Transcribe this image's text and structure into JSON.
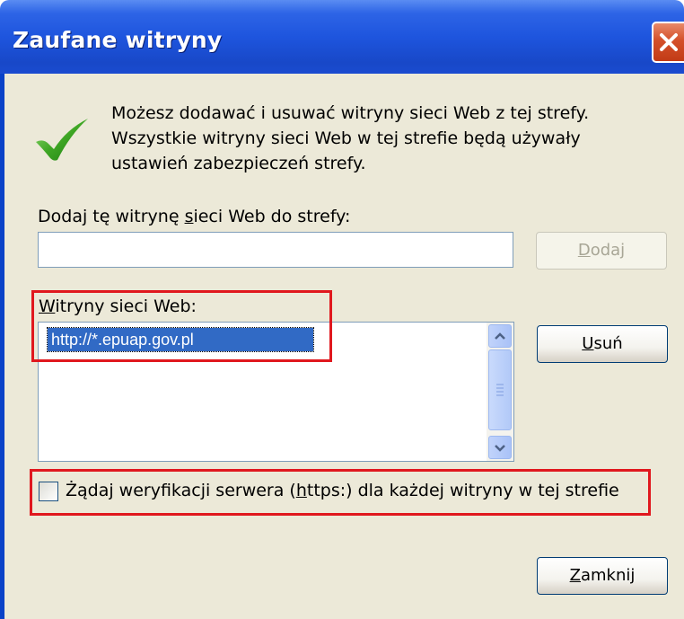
{
  "window": {
    "title": "Zaufane witryny"
  },
  "intro": {
    "lines": [
      "Możesz dodawać i usuwać witryny sieci Web z tej strefy.",
      "Wszystkie witryny sieci Web w tej strefie będą używały",
      "ustawień zabezpieczeń strefy."
    ]
  },
  "add_site": {
    "label_pre": "Dodaj tę witrynę ",
    "label_key": "s",
    "label_post": "ieci Web do strefy:",
    "input_value": "",
    "button_key": "D",
    "button_rest": "odaj"
  },
  "websites": {
    "label_key": "W",
    "label_rest": "itryny sieci Web:",
    "items": [
      "http://*.epuap.gov.pl"
    ],
    "remove_key": "U",
    "remove_rest": "suń"
  },
  "https_check": {
    "checked": false,
    "label_pre": "Żądaj weryfikacji serwera (",
    "label_key": "h",
    "label_post": "ttps:) dla każdej witryny w tej strefie"
  },
  "footer": {
    "close_key": "Z",
    "close_rest": "amknij"
  },
  "colors": {
    "titlebar": "#1e55de",
    "dialog_bg": "#ece9d8",
    "selection": "#316ac5",
    "highlight": "#e0181e"
  }
}
